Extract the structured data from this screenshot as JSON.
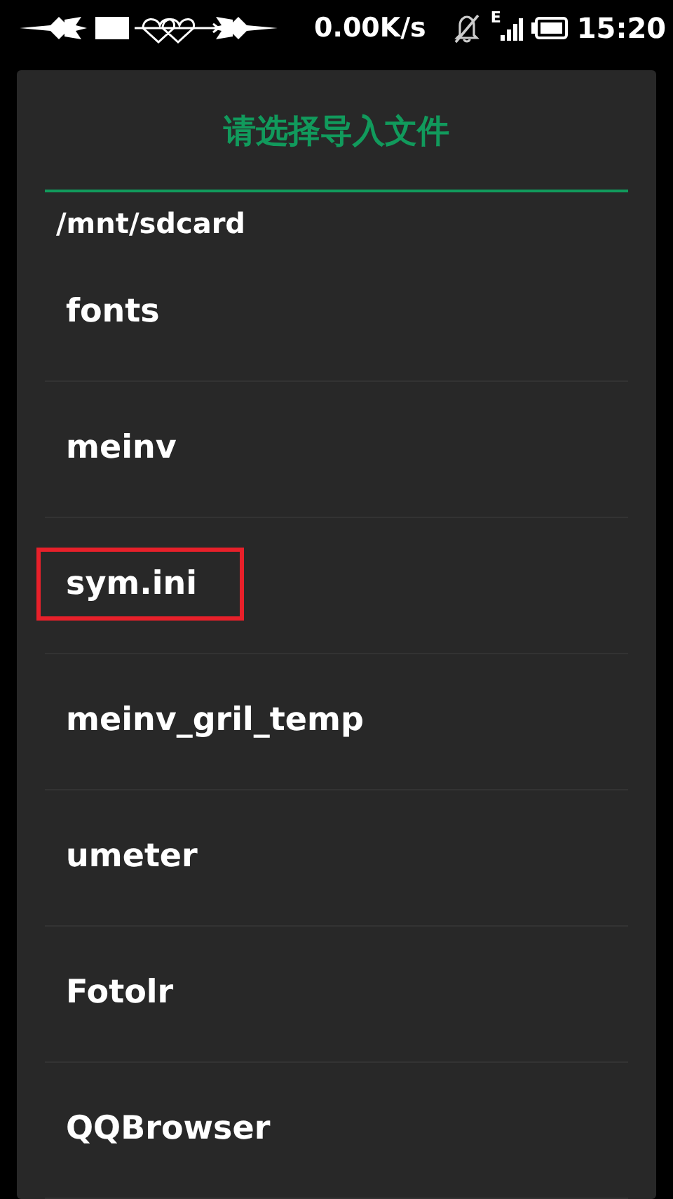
{
  "status_bar": {
    "speed": "0.00K/s",
    "network": "E",
    "time": "15:20"
  },
  "dialog": {
    "title": "请选择导入文件",
    "path": "/mnt/sdcard",
    "items": [
      {
        "name": "fonts",
        "highlighted": false
      },
      {
        "name": "meinv",
        "highlighted": false
      },
      {
        "name": "sym.ini",
        "highlighted": true
      },
      {
        "name": "meinv_gril_temp",
        "highlighted": false
      },
      {
        "name": "umeter",
        "highlighted": false
      },
      {
        "name": "Fotolr",
        "highlighted": false
      },
      {
        "name": "QQBrowser",
        "highlighted": false
      }
    ]
  }
}
